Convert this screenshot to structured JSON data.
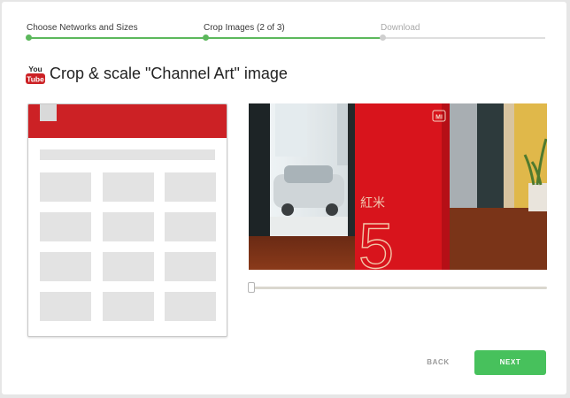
{
  "stepper": {
    "steps": [
      {
        "label": "Choose Networks and Sizes",
        "state": "done"
      },
      {
        "label": "Crop Images (2 of 3)",
        "state": "current"
      },
      {
        "label": "Download",
        "state": "todo"
      }
    ],
    "progress_percent": 68
  },
  "header": {
    "logo_text_top": "You",
    "logo_text_bottom": "Tube",
    "title": "Crop & scale \"Channel Art\" image"
  },
  "photo": {
    "box_brand": "MI",
    "box_chinese": "紅米",
    "box_number": "5"
  },
  "slider": {
    "value_percent": 0
  },
  "actions": {
    "back_label": "BACK",
    "next_label": "NEXT"
  },
  "colors": {
    "accent_green": "#47c15c",
    "progress_green": "#5cb85c",
    "youtube_red": "#cc2125"
  },
  "icons": {
    "logo": "youtube-logo-icon"
  }
}
